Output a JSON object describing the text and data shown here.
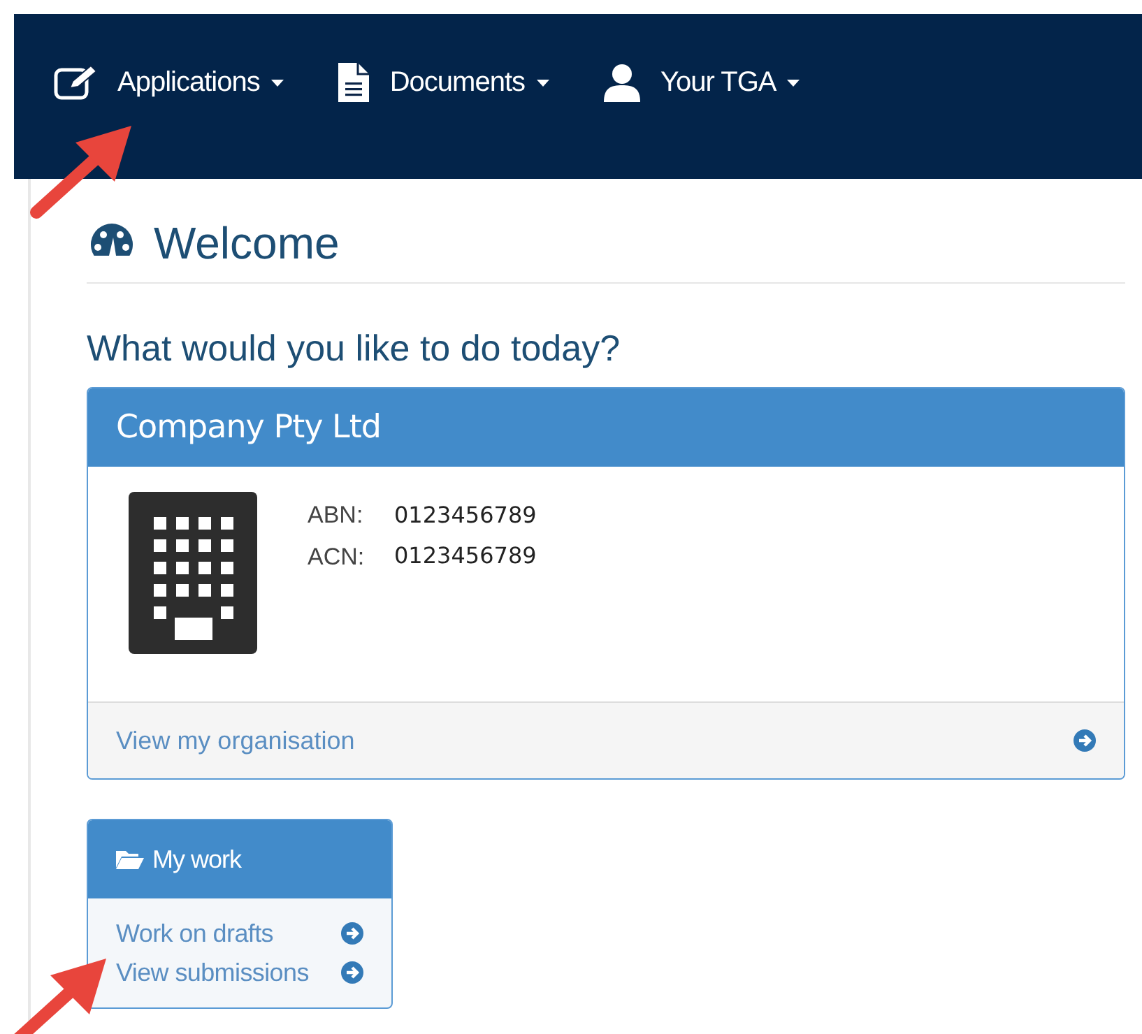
{
  "nav": {
    "items": [
      {
        "kind": "edit",
        "label": "Applications"
      },
      {
        "kind": "document",
        "label": "Documents"
      },
      {
        "kind": "user",
        "label": "Your TGA"
      }
    ]
  },
  "page": {
    "title": "Welcome",
    "question": "What would you like to do today?"
  },
  "company": {
    "name": "Company Pty Ltd",
    "fields": [
      {
        "label": "ABN:",
        "value": "0123456789"
      },
      {
        "label": "ACN:",
        "value": "0123456789"
      }
    ],
    "link": "View my organisation"
  },
  "my_work": {
    "title": "My work",
    "links": [
      "Work on drafts",
      "View submissions"
    ]
  }
}
